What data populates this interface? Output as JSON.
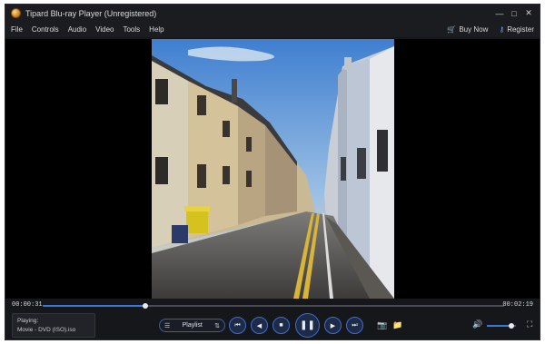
{
  "window": {
    "title": "Tipard Blu-ray Player (Unregistered)",
    "controls": {
      "minimize": "—",
      "maximize": "□",
      "close": "✕"
    }
  },
  "menu": {
    "items": [
      {
        "id": "file",
        "label": "File"
      },
      {
        "id": "controls",
        "label": "Controls"
      },
      {
        "id": "audio",
        "label": "Audio"
      },
      {
        "id": "video",
        "label": "Video"
      },
      {
        "id": "tools",
        "label": "Tools"
      },
      {
        "id": "help",
        "label": "Help"
      }
    ],
    "buy_now": "Buy Now",
    "register": "Register"
  },
  "playback": {
    "current_time": "00:00:31",
    "total_time": "00:02:19",
    "progress": 0.223,
    "volume": 0.85
  },
  "now_playing": {
    "label": "Playing:",
    "file": "Movie - DVD (ISO).iso"
  },
  "playlist_button": {
    "label": "Playlist"
  },
  "icons": {
    "app": "blu-ray-logo",
    "buy": "cart-icon",
    "register": "key-icon",
    "snapshot": "camera-icon",
    "folder": "folder-icon",
    "volume": "speaker-icon",
    "fullscreen": "fullscreen-icon"
  },
  "colors": {
    "accent": "#3e78d8",
    "background": "#16171b",
    "buy_icon": "#e8a03c"
  }
}
